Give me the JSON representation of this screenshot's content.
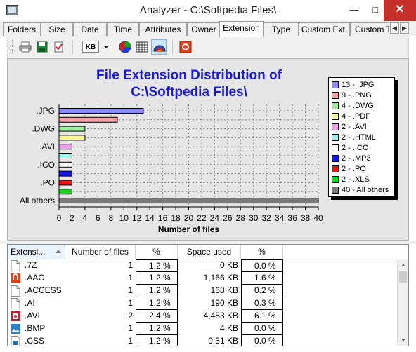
{
  "window": {
    "title": "Analyzer - C:\\Softpedia Files\\"
  },
  "tabs": [
    {
      "label": "Folders",
      "active": false
    },
    {
      "label": "Size",
      "active": false
    },
    {
      "label": "Date",
      "active": false
    },
    {
      "label": "Time",
      "active": false
    },
    {
      "label": "Attributes",
      "active": false
    },
    {
      "label": "Owner",
      "active": false
    },
    {
      "label": "Extension",
      "active": true
    },
    {
      "label": "Type",
      "active": false
    },
    {
      "label": "Custom Ext.",
      "active": false
    },
    {
      "label": "Custom T",
      "active": false
    }
  ],
  "toolbar": {
    "size_unit": "KB",
    "buttons": [
      "print-icon",
      "save-icon",
      "properties-icon",
      "kb-unit-selector",
      "pie-chart-icon",
      "grid-chart-icon",
      "bar-chart-icon",
      "options-icon"
    ]
  },
  "chart_data": {
    "type": "bar",
    "orientation": "horizontal",
    "title": "File Extension Distribution of C:\\Softpedia Files\\",
    "title_lines": [
      "File Extension Distribution of",
      "C:\\Softpedia Files\\"
    ],
    "xlabel": "Number of files",
    "xlim": [
      0,
      40
    ],
    "xticks": [
      0,
      2,
      4,
      6,
      8,
      10,
      12,
      14,
      16,
      18,
      20,
      22,
      24,
      26,
      28,
      30,
      32,
      34,
      36,
      38,
      40
    ],
    "grid": true,
    "legend_position": "right",
    "category_tick_labels": [
      ".JPG",
      ".DWG",
      ".AVI",
      ".ICO",
      ".PO",
      "All others"
    ],
    "series": [
      {
        "name": "13 - .JPG",
        "category": ".JPG",
        "value": 13,
        "color": "#8c8cf8"
      },
      {
        "name": "9 - .PNG",
        "category": ".PNG",
        "value": 9,
        "color": "#f3a1a9"
      },
      {
        "name": "4 - .DWG",
        "category": ".DWG",
        "value": 4,
        "color": "#9ef09e"
      },
      {
        "name": "4 - .PDF",
        "category": ".PDF",
        "value": 4,
        "color": "#f8f89a"
      },
      {
        "name": "2 - .AVI",
        "category": ".AVI",
        "value": 2,
        "color": "#f39ef3"
      },
      {
        "name": "2 - .HTML",
        "category": ".HTML",
        "value": 2,
        "color": "#9ef3f3"
      },
      {
        "name": "2 - .ICO",
        "category": ".ICO",
        "value": 2,
        "color": "#ffffff"
      },
      {
        "name": "2 - .MP3",
        "category": ".MP3",
        "value": 2,
        "color": "#1515e6"
      },
      {
        "name": "2 - .PO",
        "category": ".PO",
        "value": 2,
        "color": "#e61515"
      },
      {
        "name": "2 - .XLS",
        "category": ".XLS",
        "value": 2,
        "color": "#15d615"
      },
      {
        "name": "40 - All others",
        "category": "All others",
        "value": 40,
        "color": "#7a7a7a"
      }
    ]
  },
  "list": {
    "columns": [
      {
        "label": "Extensi...",
        "sorted": true
      },
      {
        "label": "Number of files"
      },
      {
        "label": "%"
      },
      {
        "label": "Space used"
      },
      {
        "label": "%"
      }
    ],
    "rows": [
      {
        "icon": "blank-file-icon",
        "ext": ".7Z",
        "count": "1",
        "pct": "1.2 %",
        "space": "0 KB",
        "space_pct": "0.0 %"
      },
      {
        "icon": "audio-file-icon",
        "ext": ".AAC",
        "count": "1",
        "pct": "1.2 %",
        "space": "1,166 KB",
        "space_pct": "1.6 %"
      },
      {
        "icon": "blank-file-icon",
        "ext": ".ACCESS",
        "count": "1",
        "pct": "1.2 %",
        "space": "168 KB",
        "space_pct": "0.2 %"
      },
      {
        "icon": "blank-file-icon",
        "ext": ".AI",
        "count": "1",
        "pct": "1.2 %",
        "space": "190 KB",
        "space_pct": "0.3 %"
      },
      {
        "icon": "video-file-icon",
        "ext": ".AVI",
        "count": "2",
        "pct": "2.4 %",
        "space": "4,483 KB",
        "space_pct": "6.1 %"
      },
      {
        "icon": "image-file-icon",
        "ext": ".BMP",
        "count": "1",
        "pct": "1.2 %",
        "space": "4 KB",
        "space_pct": "0.0 %"
      },
      {
        "icon": "css-file-icon",
        "ext": ".CSS",
        "count": "1",
        "pct": "1.2 %",
        "space": "0.31 KB",
        "space_pct": "0.0 %"
      }
    ]
  }
}
